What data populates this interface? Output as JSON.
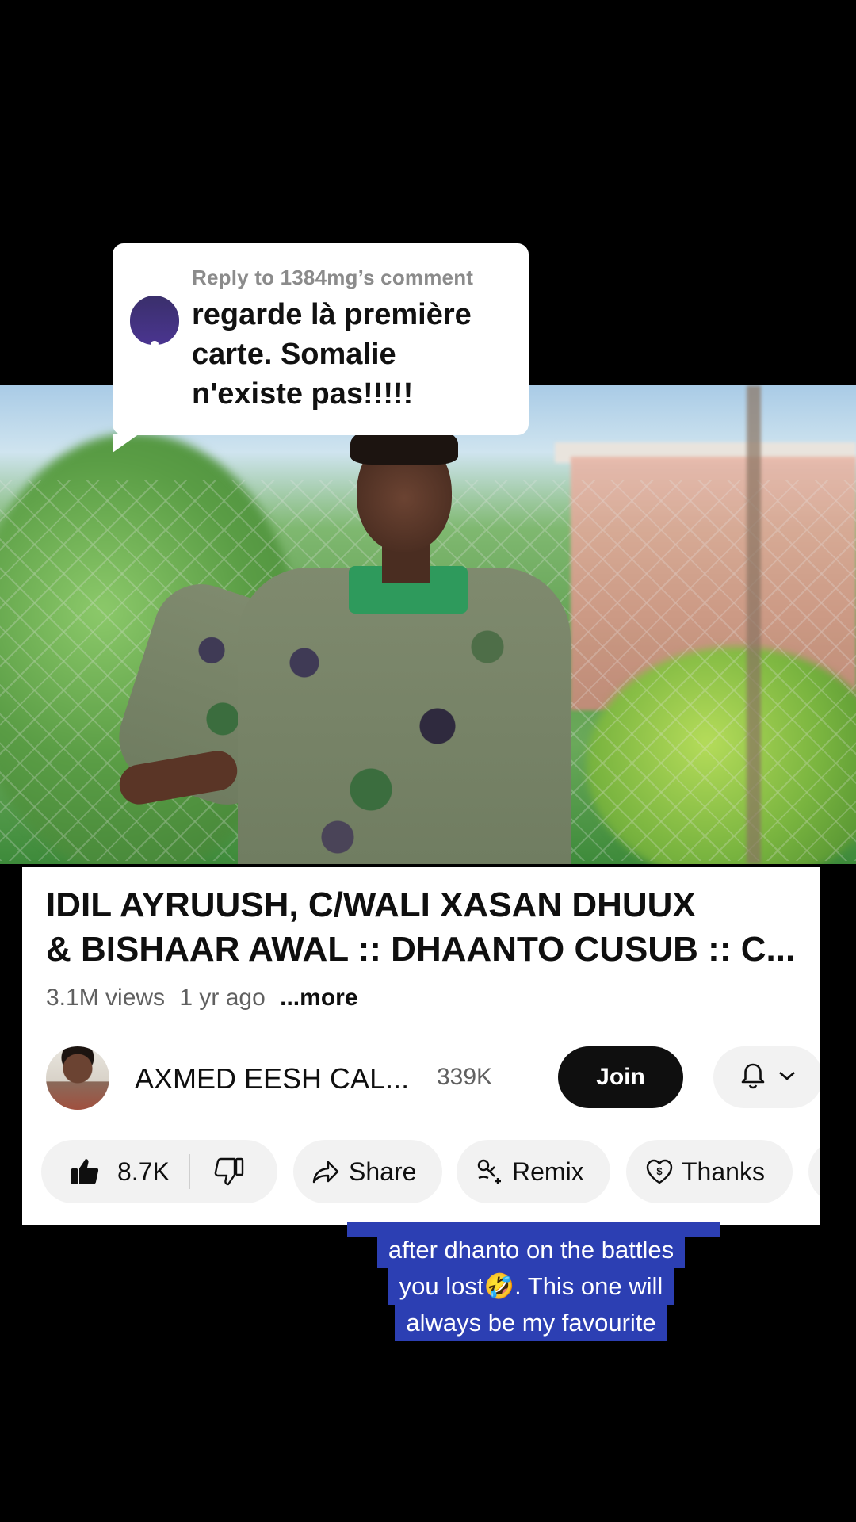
{
  "reply": {
    "title": "Reply to 1384mg’s comment",
    "line1": "regarde là première",
    "line2": "carte. Somalie",
    "line3": "n'existe pas!!!!!"
  },
  "video": {
    "title_line1": "IDIL AYRUUSH, C/WALI XASAN DHUUX",
    "title_line2": "& BISHAAR AWAL :: DHAANTO CUSUB :: C...",
    "views": "3.1M views",
    "age": "1 yr ago",
    "more": "...more"
  },
  "channel": {
    "name": "AXMED EESH CAL...",
    "subscribers": "339K",
    "join_label": "Join"
  },
  "actions": {
    "likes": "8.7K",
    "share_label": "Share",
    "remix_label": "Remix",
    "thanks_label": "Thanks"
  },
  "caption": {
    "line2": "after dhanto on the battles",
    "line3": "you lost🤣. This one will",
    "line4": "always be my favourite"
  },
  "colors": {
    "caption_bg": "#2c3fb3",
    "join_bg": "#0f0f0f",
    "pill_bg": "#f2f2f2"
  }
}
